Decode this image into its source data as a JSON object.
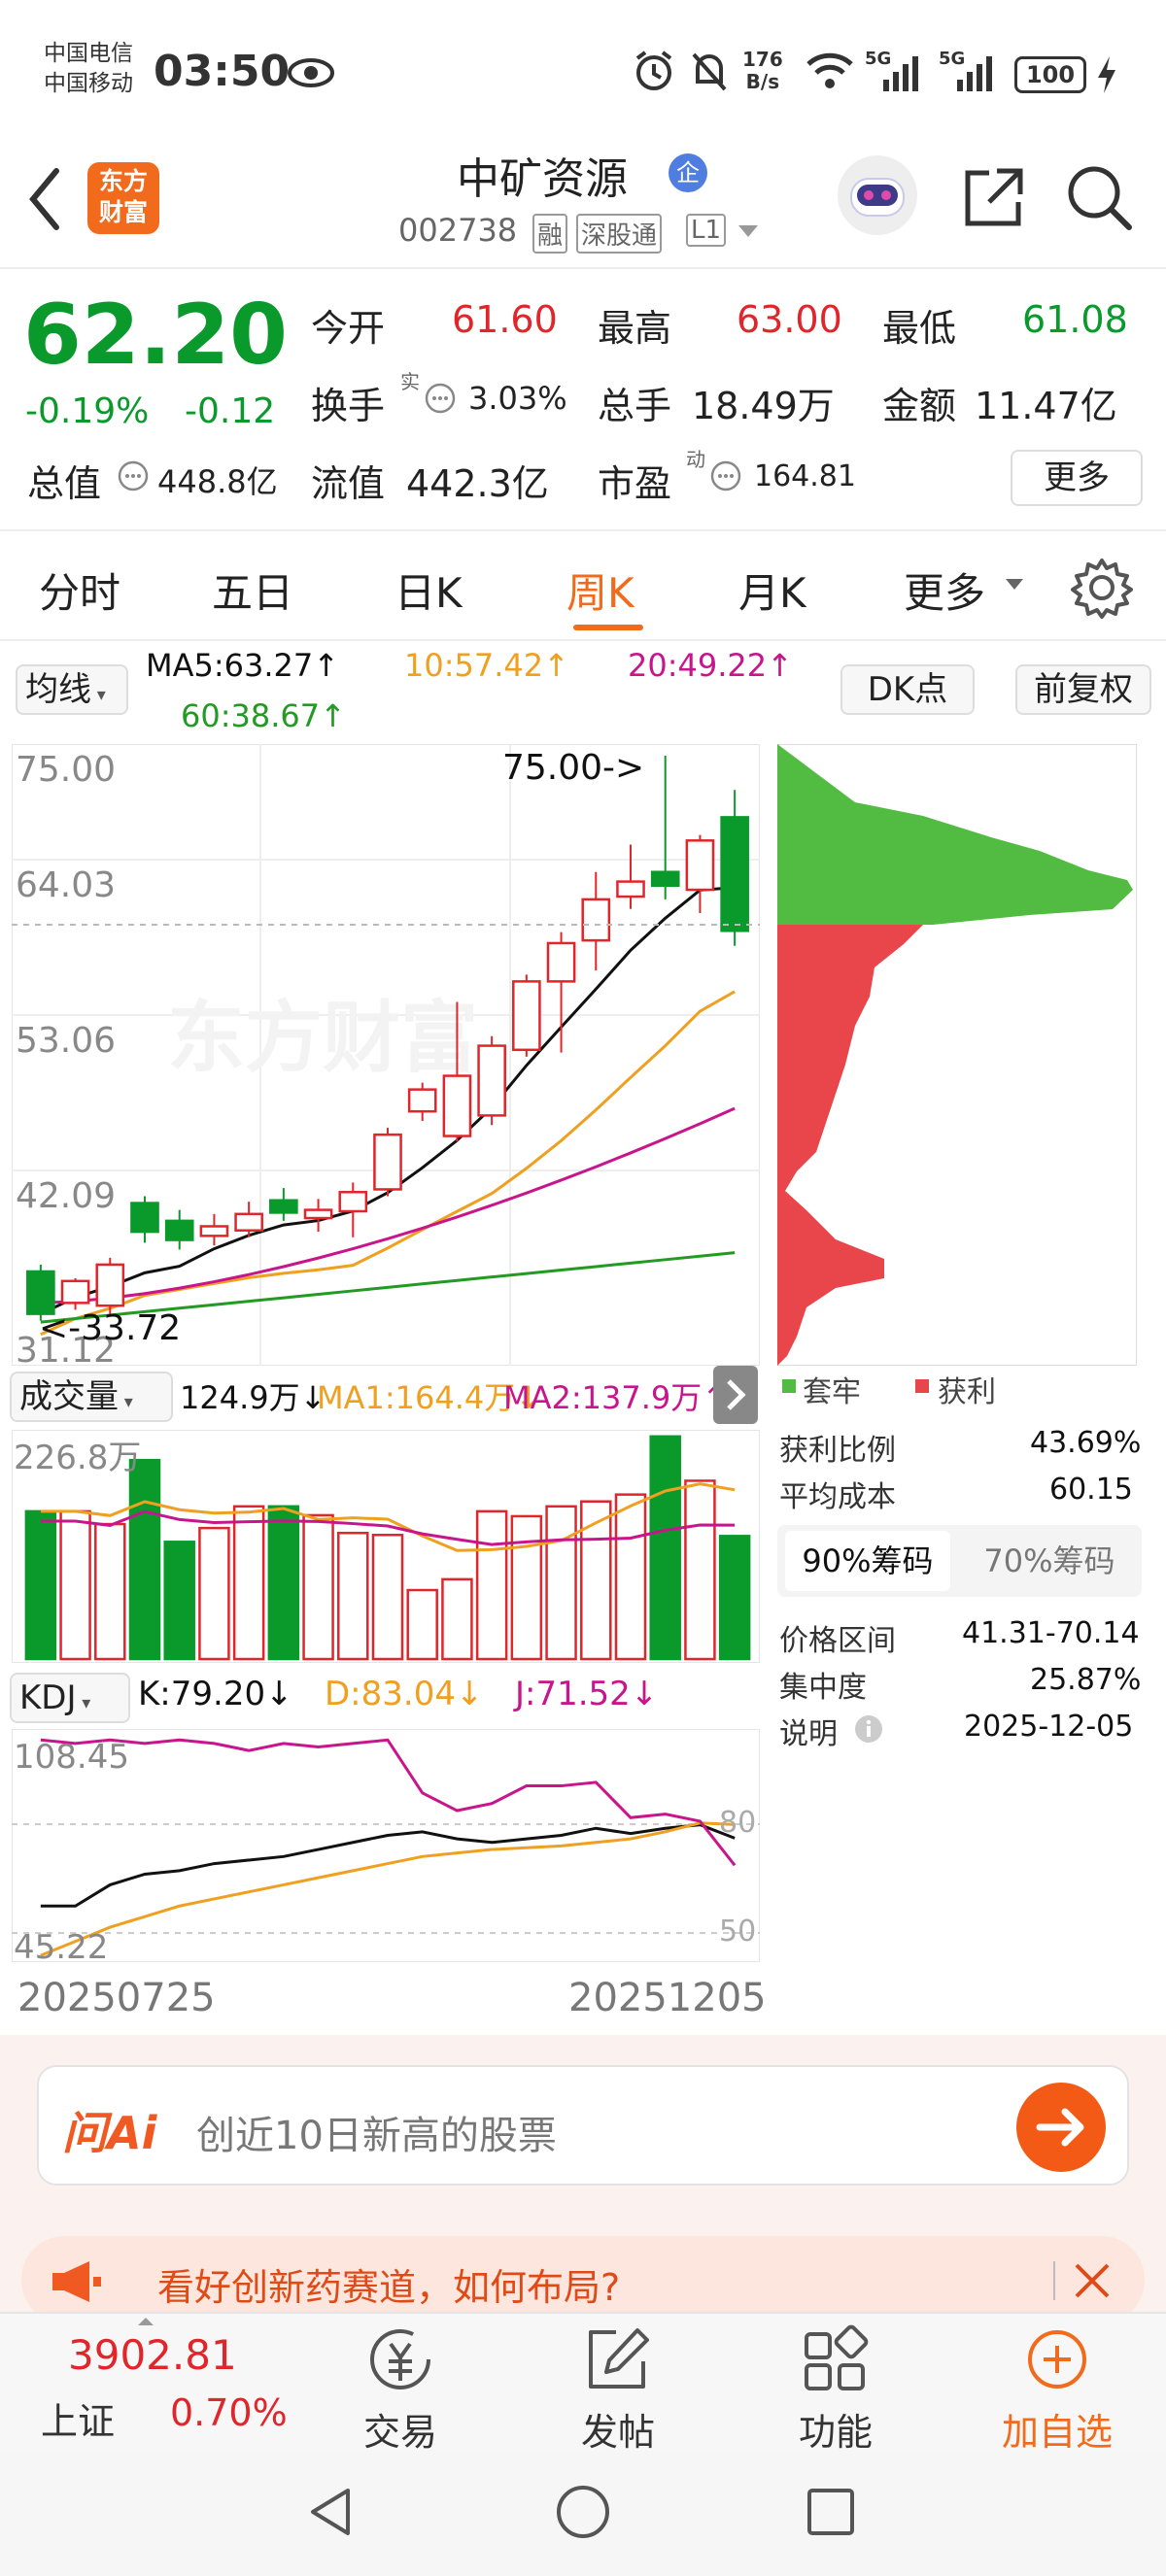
{
  "status": {
    "carrier1": "中国电信",
    "carrier2": "中国移动",
    "time": "03:50",
    "net_speed_value": "176",
    "net_speed_unit": "B/s",
    "sig1": "5G",
    "sig2": "5G",
    "battery": "100"
  },
  "header": {
    "logo_line1": "东方",
    "logo_line2": "财富",
    "stock_name": "中矿资源",
    "stock_badge": "企",
    "stock_code": "002738",
    "tag_rong": "融",
    "tag_sgt": "深股通",
    "tag_level": "L1"
  },
  "quote": {
    "price": "62.20",
    "change_pct": "-0.19%",
    "change": "-0.12",
    "open_label": "今开",
    "open": "61.60",
    "high_label": "最高",
    "high": "63.00",
    "low_label": "最低",
    "low": "61.08",
    "turnover_label": "换手",
    "turnover_sup": "实",
    "turnover": "3.03%",
    "volume_label": "总手",
    "volume": "18.49万",
    "amount_label": "金额",
    "amount": "11.47亿",
    "mcap_label": "总值",
    "mcap": "448.8亿",
    "float_label": "流值",
    "float_cap": "442.3亿",
    "pe_label": "市盈",
    "pe_sup": "动",
    "pe": "164.81",
    "more": "更多"
  },
  "tabs": {
    "items": [
      "分时",
      "五日",
      "日K",
      "周K",
      "月K",
      "更多"
    ],
    "active": "周K"
  },
  "chart_bar": {
    "ma_select": "均线",
    "ma5": "MA5:63.27↑",
    "ma10": "10:57.42↑",
    "ma20": "20:49.22↑",
    "ma60": "60:38.67↑",
    "dk": "DK点",
    "restore": "前复权"
  },
  "price_chart_labels": {
    "y1": "75.00",
    "y2": "64.03",
    "y3": "53.06",
    "y4": "42.09",
    "y5": "31.12",
    "max_marker": "75.00->",
    "min_marker": "<-33.72",
    "watermark": "东方财富"
  },
  "chips": {
    "legend_trapped": "套牢",
    "legend_profit": "获利",
    "rows": [
      {
        "label": "获利比例",
        "value": "43.69%"
      },
      {
        "label": "平均成本",
        "value": "60.15"
      }
    ],
    "tab90": "90%筹码",
    "tab70": "70%筹码",
    "rows2": [
      {
        "label": "价格区间",
        "value": "41.31-70.14"
      },
      {
        "label": "集中度",
        "value": "25.87%"
      },
      {
        "label": "说明",
        "value": "2025-12-05"
      }
    ]
  },
  "volume": {
    "select": "成交量",
    "vol": "124.9万↓",
    "ma1": "MA1:164.4万↓",
    "ma2": "MA2:137.9万↑",
    "ymax": "226.8万"
  },
  "kdj": {
    "select": "KDJ",
    "k": "K:79.20↓",
    "d": "D:83.04↓",
    "j": "J:71.52↓",
    "ymax": "108.45",
    "ymin": "45.22",
    "l80": "80",
    "l50": "50"
  },
  "dates": {
    "start": "20250725",
    "end": "20251205"
  },
  "ai": {
    "brand": "问Ai",
    "placeholder": "创近10日新高的股票"
  },
  "banner": {
    "text": "看好创新药赛道，如何布局?"
  },
  "bottom": {
    "index_value": "3902.81",
    "index_name": "上证",
    "index_pct": "0.70%",
    "trade": "交易",
    "post": "发帖",
    "features": "功能",
    "add": "加自选"
  },
  "colors": {
    "up": "#e0252b",
    "down": "#0a9a2c",
    "accent": "#f26a1b",
    "ma5": "#111111",
    "ma10": "#f0a020",
    "ma20": "#c8158c",
    "ma60": "#239a23"
  },
  "chart_data": [
    {
      "type": "candlestick",
      "title": "周K",
      "x": [
        "20250725",
        "20251205"
      ],
      "ylim": [
        31.12,
        75.0
      ],
      "series": [
        {
          "name": "MA5",
          "last": 63.27
        },
        {
          "name": "MA10",
          "last": 57.42
        },
        {
          "name": "MA20",
          "last": 49.22
        },
        {
          "name": "MA60",
          "last": 38.67
        }
      ],
      "ohlc": [
        [
          37.3,
          34.2,
          37.8,
          33.7
        ],
        [
          35.0,
          36.6,
          36.8,
          34.5
        ],
        [
          34.8,
          37.8,
          38.3,
          34.2
        ],
        [
          42.3,
          40.2,
          42.8,
          39.4
        ],
        [
          41.0,
          39.6,
          41.8,
          38.9
        ],
        [
          39.9,
          40.6,
          41.5,
          39.2
        ],
        [
          40.3,
          41.5,
          42.4,
          39.8
        ],
        [
          42.5,
          41.6,
          43.4,
          41.0
        ],
        [
          41.2,
          41.8,
          42.6,
          40.2
        ],
        [
          41.7,
          43.1,
          43.8,
          39.8
        ],
        [
          43.3,
          47.3,
          47.8,
          42.8
        ],
        [
          49.0,
          50.6,
          51.1,
          48.3
        ],
        [
          47.2,
          51.6,
          57.0,
          46.8
        ],
        [
          48.7,
          53.8,
          54.5,
          48.0
        ],
        [
          53.5,
          58.5,
          59.0,
          53.0
        ],
        [
          58.5,
          61.3,
          62.1,
          53.3
        ],
        [
          61.5,
          64.5,
          66.5,
          59.3
        ],
        [
          64.7,
          65.8,
          68.5,
          63.8
        ],
        [
          66.5,
          65.5,
          75.0,
          64.5
        ],
        [
          65.2,
          68.8,
          69.2,
          63.5
        ],
        [
          70.5,
          62.2,
          72.5,
          61.1
        ]
      ]
    },
    {
      "type": "bar",
      "title": "成交量",
      "ylabel": "",
      "ylim": [
        0,
        226.8
      ],
      "values": [
        150,
        150,
        137,
        202,
        119,
        133,
        155,
        155,
        146,
        128,
        126,
        70,
        81,
        150,
        145,
        155,
        160,
        167,
        226,
        181,
        124.9
      ],
      "series": [
        {
          "name": "MA1",
          "last": 164.4
        },
        {
          "name": "MA2",
          "last": 137.9
        }
      ]
    },
    {
      "type": "line",
      "title": "KDJ",
      "ylim": [
        45.22,
        108.45
      ],
      "series": [
        {
          "name": "K",
          "last": 79.2
        },
        {
          "name": "D",
          "last": 83.04
        },
        {
          "name": "J",
          "last": 71.52
        }
      ]
    }
  ]
}
